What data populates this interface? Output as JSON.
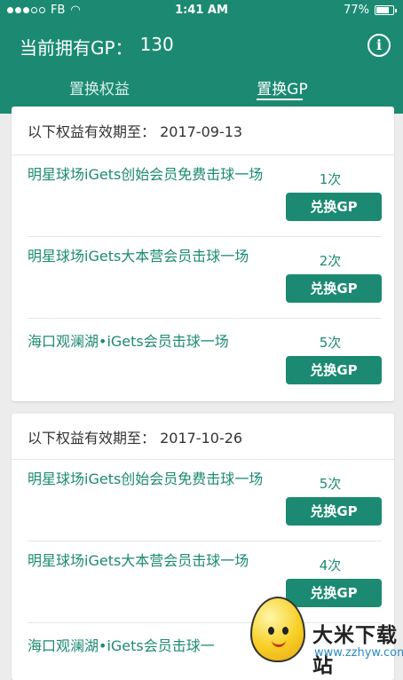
{
  "status_bar": {
    "carrier": "FB",
    "time": "1:41 AM",
    "battery": "77%",
    "battery_level": 0.77
  },
  "header": {
    "gp_label": "当前拥有GP：",
    "gp_value": "130",
    "info_icon": "info-icon"
  },
  "tabs": [
    {
      "label": "置换权益",
      "active": false
    },
    {
      "label": "置换GP",
      "active": true
    }
  ],
  "cards": [
    {
      "valid_until": "以下权益有效期至：   2017-09-13",
      "items": [
        {
          "name": "明星球场iGets创始会员免费击球一场",
          "count": "1次",
          "button": "兑换GP"
        },
        {
          "name": "明星球场iGets大本营会员击球一场",
          "count": "2次",
          "button": "兑换GP"
        },
        {
          "name": "海口观澜湖•iGets会员击球一场",
          "count": "5次",
          "button": "兑换GP"
        }
      ]
    },
    {
      "valid_until": "以下权益有效期至：  2017-10-26",
      "items": [
        {
          "name": "明星球场iGets创始会员免费击球一场",
          "count": "5次",
          "button": "兑换GP"
        },
        {
          "name": "明星球场iGets大本营会员击球一场",
          "count": "4次",
          "button": "兑换GP"
        },
        {
          "name": "海口观澜湖•iGets会员击球一",
          "count": "",
          "button": ""
        }
      ]
    }
  ],
  "watermark": {
    "title": "大米下载站",
    "url": "www.zzhyw.com"
  },
  "colors": {
    "primary": "#1c8a72",
    "background": "#ececec"
  }
}
